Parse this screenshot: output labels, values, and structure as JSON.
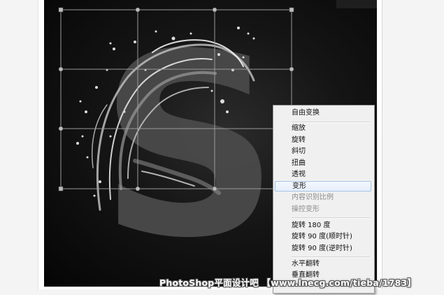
{
  "canvas": {
    "letter": "S",
    "background_color": "#0a0a0a",
    "letter_color": "#4a4a4a"
  },
  "context_menu": {
    "items": [
      {
        "label": "自由变换",
        "enabled": true
      },
      {
        "label": "缩放",
        "enabled": true
      },
      {
        "label": "旋转",
        "enabled": true
      },
      {
        "label": "斜切",
        "enabled": true
      },
      {
        "label": "扭曲",
        "enabled": true
      },
      {
        "label": "透视",
        "enabled": true
      },
      {
        "label": "变形",
        "enabled": true,
        "highlighted": true
      },
      {
        "label": "内容识别比例",
        "enabled": false
      },
      {
        "label": "操控变形",
        "enabled": false
      },
      {
        "label": "旋转 180 度",
        "enabled": true
      },
      {
        "label": "旋转 90 度(顺时针)",
        "enabled": true
      },
      {
        "label": "旋转 90 度(逆时针)",
        "enabled": true
      },
      {
        "label": "水平翻转",
        "enabled": true
      },
      {
        "label": "垂直翻转",
        "enabled": true
      }
    ],
    "highlight_color": "#a8c4e8"
  },
  "watermark": {
    "text": "PhotoShop平面设计吧 【www.lnecg.com/tieba/1783】"
  }
}
